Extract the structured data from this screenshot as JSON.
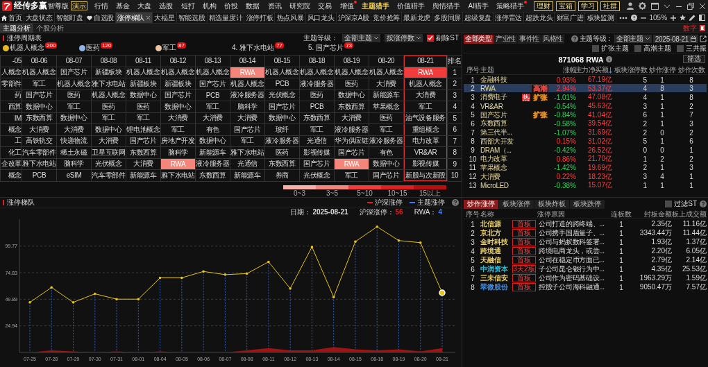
{
  "app": {
    "brand": "经传多赢",
    "edition": "智尊版",
    "badge": "演示"
  },
  "menu": [
    {
      "label": "行情",
      "selected": false,
      "dot": false
    },
    {
      "label": "基金",
      "selected": false,
      "dot": false
    },
    {
      "label": "大盘",
      "selected": false,
      "dot": false
    },
    {
      "label": "选股",
      "selected": false,
      "dot": false
    },
    {
      "label": "短打",
      "selected": false,
      "dot": false
    },
    {
      "label": "机构",
      "selected": false,
      "dot": false
    },
    {
      "label": "价投",
      "selected": false,
      "dot": false
    },
    {
      "label": "数据",
      "selected": false,
      "dot": false
    },
    {
      "label": "资讯",
      "selected": false,
      "dot": false
    },
    {
      "label": "研究院",
      "selected": false,
      "dot": false
    },
    {
      "label": "交易",
      "selected": false,
      "dot": false
    },
    {
      "label": "增值",
      "selected": false,
      "dot": true
    },
    {
      "label": "主题猎手",
      "selected": true,
      "dot": false
    },
    {
      "label": "价值猎手",
      "selected": false,
      "dot": false
    },
    {
      "label": "舆情猎手",
      "selected": false,
      "dot": false
    },
    {
      "label": "AI猎手",
      "selected": false,
      "dot": false
    },
    {
      "label": "策略猎手",
      "selected": false,
      "dot": true
    }
  ],
  "account_buttons": [
    "理财",
    "宝箱",
    "学习",
    "社群"
  ],
  "tabs": [
    {
      "label": "首页",
      "kind": "home",
      "selected": false
    },
    {
      "label": "大盘状态",
      "kind": "plain",
      "selected": false
    },
    {
      "label": "智能盯盘",
      "kind": "plain",
      "selected": false
    },
    {
      "label": "自选股",
      "kind": "favorite",
      "selected": false
    },
    {
      "label": "涨停梯队",
      "kind": "plain",
      "selected": true
    },
    {
      "label": "大福星",
      "kind": "plain",
      "selected": false
    },
    {
      "label": "智能选股",
      "kind": "plain",
      "selected": false
    },
    {
      "label": "精选量度计",
      "kind": "plain",
      "selected": false
    },
    {
      "label": "涨停打板",
      "kind": "plain",
      "selected": false
    },
    {
      "label": "热点风暴",
      "kind": "plain",
      "selected": false
    },
    {
      "label": "风口龙头",
      "kind": "plain",
      "selected": false
    },
    {
      "label": "沪深京A股",
      "kind": "plain",
      "selected": false
    },
    {
      "label": "竞价抢筹",
      "kind": "plain",
      "selected": false
    },
    {
      "label": "最新龙虎",
      "kind": "plain",
      "selected": false
    },
    {
      "label": "多股同屏",
      "kind": "plain",
      "selected": false
    },
    {
      "label": "超级复盘",
      "kind": "plain",
      "selected": false
    },
    {
      "label": "涨停雷达",
      "kind": "plain",
      "selected": false
    },
    {
      "label": "超跌龙头",
      "kind": "plain",
      "selected": false
    },
    {
      "label": "财富广进",
      "kind": "plain",
      "selected": false
    },
    {
      "label": "板块监测",
      "kind": "plain",
      "selected": false
    }
  ],
  "zoom": "105%",
  "subtabs": [
    {
      "label": "主题分析",
      "selected": true
    },
    {
      "label": "个股分析",
      "selected": false
    }
  ],
  "corner_label": "数字",
  "cycle": {
    "title": "涨停周期表",
    "themes": [
      {
        "kind": "medal",
        "label": "机器人概念",
        "count": "200",
        "color": "#e8b820"
      },
      {
        "kind": "medal",
        "label": "医药",
        "count": "120",
        "color": "#8fb4e8"
      },
      {
        "kind": "medal",
        "label": "军工",
        "count": "87",
        "color": "#e8c4a0"
      },
      {
        "kind": "numbered",
        "label": "4. 雅下水电站",
        "count": "77"
      },
      {
        "kind": "numbered",
        "label": "5. 国产芯片",
        "count": "73"
      }
    ],
    "level_label": "主题等级：",
    "level": "全部主题",
    "sort": "按涨停数",
    "exclude_st": {
      "label": "剔除ST",
      "checked": true
    },
    "columns": [
      {
        "label": "-05",
        "selected": false
      },
      {
        "label": "08-06",
        "selected": false
      },
      {
        "label": "08-07",
        "selected": false
      },
      {
        "label": "08-08",
        "selected": false
      },
      {
        "label": "08-11",
        "selected": false
      },
      {
        "label": "08-12",
        "selected": false
      },
      {
        "label": "08-13",
        "selected": false
      },
      {
        "label": "08-14",
        "selected": false
      },
      {
        "label": "08-15",
        "selected": false
      },
      {
        "label": "08-18",
        "selected": false
      },
      {
        "label": "08-19",
        "selected": false
      },
      {
        "label": "08-20",
        "selected": false
      },
      {
        "label": "08-21",
        "selected": true
      }
    ],
    "rank_label": "排名",
    "rows": [
      {
        "rank": "1",
        "cells": [
          "人概念",
          "机器人概念",
          "国产芯片",
          "新疆板块",
          "机器人概念",
          "机器人概念",
          "机器人概念",
          {
            "text": "RWA",
            "color": "#f4857a"
          },
          "机器人概念",
          "机器人概念",
          "机器人概念",
          "机器人概念",
          {
            "text": "RWA",
            "color": "#f23c3c"
          }
        ]
      },
      {
        "rank": "2",
        "cells": [
          "零部件",
          "军工",
          "机器人概念",
          "雅下水电站",
          "新疆板块",
          "新疆板块",
          "国产芯片",
          "机器人概念",
          "PCB",
          "液冷服务器",
          "医药",
          "大消费",
          "机器人概念"
        ]
      },
      {
        "rank": "3",
        "cells": [
          "药",
          "国产芯片",
          "医药",
          "机器人概念",
          "数据中心",
          "国产芯片",
          "PCB",
          "液冷服务器",
          "光伏概念",
          "医药",
          "数据中心",
          "新能源车",
          "大消费"
        ]
      },
      {
        "rank": "4",
        "cells": [
          "西算",
          "数据中心",
          "军工",
          "医药",
          "医药",
          "数据中心",
          "军工",
          "脑科学",
          "国产芯片",
          "PCB",
          "东数西算",
          "苹果概念",
          "军工"
        ]
      },
      {
        "rank": "5",
        "cells": [
          "IM",
          "东数西算",
          "数据中心",
          "军工",
          "军工",
          "大消费",
          "大消费",
          "大消费",
          "数据中心",
          "东数西算",
          "大消费",
          "医药",
          "油气设备服务"
        ]
      },
      {
        "rank": "6",
        "cells": [
          "概念",
          "大消费",
          "大消费",
          "数据中心",
          "锂电池概念",
          "军工",
          "有色",
          "国产芯片",
          "玻纤",
          "军工",
          "液冷服务器",
          "军工",
          "重组概念"
        ]
      },
      {
        "rank": "7",
        "cells": [
          "工",
          "高铁轨交",
          "快递物流",
          "大消费",
          "国产芯片",
          "房地产开发",
          "数据中心",
          "军工",
          "液冷服务器",
          "光通信",
          "华为供应链",
          "液冷服务器",
          "电力改革"
        ]
      },
      {
        "rank": "8",
        "cells": [
          "化工",
          "汽车零部件",
          "稀土永磁",
          "卫星互联网",
          "东数西算",
          "脑科学",
          "新能源车",
          "雅下水电站",
          "医药",
          "影视传媒",
          "国产芯片",
          "有色",
          "VR&AR"
        ]
      },
      {
        "rank": "9",
        "cells": [
          "企改革",
          "雅下水电站",
          "脑科学",
          "光伏概念",
          "大消费",
          {
            "text": "RWA",
            "color": "#f4857a"
          },
          "液冷服务器",
          "光通信",
          "东数西算",
          "国产芯片",
          {
            "text": "RWA",
            "color": "#f4857a"
          },
          "数据中心",
          "影视传媒"
        ]
      },
      {
        "rank": "10",
        "cells": [
          "概念",
          "PCB",
          "eSIM",
          "汽车零部件",
          "新能源车",
          "雅下水电站",
          "东数西算",
          "新能源车",
          "券商",
          "光伏概念",
          "军工",
          "国产芯片",
          "新股与次新股"
        ]
      }
    ],
    "legend": [
      {
        "label": "0~3",
        "color": "#f9b0a8"
      },
      {
        "label": "3~5",
        "color": "#f4857a"
      },
      {
        "label": "5~10",
        "color": "#f23c3c"
      },
      {
        "label": "10~15",
        "color": "#dc2020"
      },
      {
        "label": "15以上",
        "color": "#b81010"
      }
    ]
  },
  "trend": {
    "title": "涨停梯队",
    "legend_marks": [
      {
        "color": "#e02020"
      },
      {
        "color": "#3a7bff"
      }
    ],
    "info": [
      {
        "label": "日期：",
        "value": "2025-08-21",
        "color": "#dddddd"
      },
      {
        "label": "沪深涨停：",
        "value": "56",
        "color": "#e02020"
      },
      {
        "label": "RWA：",
        "value": "4",
        "color": "#3a7bff"
      }
    ],
    "chart_data": {
      "type": "line",
      "grid": true,
      "categories": [
        "07-25",
        "07-28",
        "07-29",
        "07-30",
        "07-31",
        "08-01",
        "08-04",
        "08-05",
        "08-06",
        "08-07",
        "08-08",
        "08-11",
        "08-12",
        "08-13",
        "08-14",
        "08-15",
        "08-18",
        "08-19",
        "08-20",
        "08-21"
      ],
      "ylim": [
        0,
        125
      ],
      "yticks": [
        24.94,
        49.89,
        74.83,
        99.77
      ],
      "series": [
        {
          "name": "沪深涨停",
          "type": "line",
          "color": "#e6c619",
          "values": [
            47,
            61,
            47,
            55,
            50,
            50,
            70,
            70,
            76,
            73,
            74,
            85,
            60,
            99,
            52,
            104,
            118,
            105,
            103,
            56
          ]
        },
        {
          "name": "主题涨停",
          "type": "area",
          "color": "#9b1515",
          "values": [
            0,
            2,
            1,
            0,
            1,
            0,
            1,
            0,
            0,
            0,
            2,
            4,
            2,
            2,
            5,
            3,
            2,
            3,
            1,
            4
          ]
        }
      ]
    }
  },
  "themes": {
    "tabs": [
      {
        "label": "全部类型",
        "selected": true
      },
      {
        "label": "产业性",
        "selected": false
      },
      {
        "label": "事件性",
        "selected": false
      },
      {
        "label": "风格性",
        "selected": false
      }
    ],
    "level_label": "主题等级：",
    "level": "全部主题",
    "date": "2025-08-21",
    "filters": [
      {
        "label": "扩张主题",
        "checked": false
      },
      {
        "label": "高潮主题",
        "checked": false
      },
      {
        "label": "三共振",
        "checked": false
      }
    ],
    "title": "871068 RWA",
    "filter_button": "筛选",
    "columns": [
      {
        "label": "序号",
        "sorted": false
      },
      {
        "label": "主题",
        "sorted": false
      },
      {
        "label": "涨幅",
        "sorted": false
      },
      {
        "label": "主力净买额",
        "sorted": true
      },
      {
        "label": "板块涨停数",
        "sorted": false
      },
      {
        "label": "炒作涨停",
        "sorted": false
      },
      {
        "label": "炒作次数",
        "sorted": false
      }
    ],
    "rows": [
      {
        "no": "1",
        "name": "金融科技",
        "change": "0.93%",
        "up": true,
        "net": "67.19亿",
        "count": "5",
        "hype": "1",
        "times": "8",
        "selected": false
      },
      {
        "no": "2",
        "name": "RWA",
        "tag": {
          "label": "高潮",
          "color": "#e04848"
        },
        "change": "2.94%",
        "up": true,
        "net": "53.37亿",
        "count": "4",
        "hype": "8",
        "times": "3",
        "selected": true
      },
      {
        "no": "3",
        "name": "消费电子",
        "hot": "热",
        "tag": {
          "label": "扩张",
          "color": "#e8902a"
        },
        "change": "-1.01%",
        "up": false,
        "net": "47.08亿",
        "count": "4",
        "hype": "1",
        "times": "8",
        "selected": false
      },
      {
        "no": "4",
        "name": "VR&AR",
        "change": "-0.54%",
        "up": false,
        "net": "45.63亿",
        "count": "3",
        "hype": "1",
        "times": "2",
        "selected": false
      },
      {
        "no": "5",
        "name": "国产芯片",
        "tag": {
          "label": "扩张",
          "color": "#e8902a"
        },
        "change": "-0.84%",
        "up": false,
        "net": "41.04亿",
        "count": "6",
        "hype": "1",
        "times": "7",
        "selected": false
      },
      {
        "no": "6",
        "name": "东数西算",
        "change": "-0.58%",
        "up": false,
        "net": "39.54亿",
        "count": "2",
        "hype": "1",
        "times": "3",
        "selected": false
      },
      {
        "no": "7",
        "name": "第三代半...",
        "change": "-1.07%",
        "up": false,
        "net": "31.69亿",
        "count": "2",
        "hype": "0",
        "times": "2",
        "selected": false
      },
      {
        "no": "8",
        "name": "西部大开发",
        "change": "0.15%",
        "up": true,
        "net": "31.02亿",
        "count": "5",
        "hype": "1",
        "times": "6",
        "selected": false
      },
      {
        "no": "9",
        "name": "DRAM（...",
        "change": "-0.42%",
        "up": false,
        "net": "26.52亿",
        "count": "0",
        "hype": "0",
        "times": "1",
        "selected": false
      },
      {
        "no": "10",
        "name": "电力改革",
        "change": "0.86%",
        "up": true,
        "net": "21.70亿",
        "count": "1",
        "hype": "2",
        "times": "2",
        "selected": false
      },
      {
        "no": "11",
        "name": "苹果概念",
        "change": "-1.42%",
        "up": false,
        "net": "19.69亿",
        "count": "2",
        "hype": "1",
        "times": "3",
        "selected": false
      },
      {
        "no": "12",
        "name": "大消费",
        "change": "0.22%",
        "up": true,
        "net": "18.23亿",
        "count": "3",
        "hype": "4",
        "times": "1",
        "selected": false
      },
      {
        "no": "13",
        "name": "MicroLED",
        "change": "-0.38%",
        "up": false,
        "net": "15.07亿",
        "count": "1",
        "hype": "1",
        "times": "1",
        "selected": false
      }
    ]
  },
  "limit_ups": {
    "tabs": [
      {
        "label": "炒作涨停",
        "selected": true
      },
      {
        "label": "板块涨停",
        "selected": false
      },
      {
        "label": "板块炸板",
        "selected": false
      },
      {
        "label": "板块跌停",
        "selected": false
      }
    ],
    "filter_st": {
      "label": "过滤ST",
      "checked": false
    },
    "columns": [
      "序号",
      "名称",
      "涨停原因",
      "连板数",
      "封板金额",
      "板上成交额"
    ],
    "rows": [
      {
        "no": "1",
        "name": "北信源",
        "color": "#e8d070",
        "tag": "首板",
        "reason": "公司打造的跨终端、...",
        "boards": "1",
        "seal": "2.35亿",
        "turnover": "11.16亿"
      },
      {
        "no": "2",
        "name": "京北方",
        "color": "#e8d070",
        "tag": "首板",
        "reason": "公司携手国盾量子、...",
        "boards": "1",
        "seal": "3343.44万",
        "turnover": "11.44亿"
      },
      {
        "no": "3",
        "name": "金时科技",
        "color": "#e8d070",
        "tag": "首板",
        "reason": "公司与蚂蚁数科签署...",
        "boards": "1",
        "seal": "1.93亿",
        "turnover": "1.37亿"
      },
      {
        "no": "4",
        "name": "跨境通",
        "color": "#e8d070",
        "tag": "首板",
        "reason": "跨境电商龙头，或尝...",
        "boards": "1",
        "seal": "2.20亿",
        "turnover": "6.05亿"
      },
      {
        "no": "5",
        "name": "天融信",
        "color": "#e8d070",
        "tag": "首板",
        "reason": "公司在稳定币方面已...",
        "boards": "1",
        "seal": "2.79亿",
        "turnover": "2.14亿"
      },
      {
        "no": "6",
        "name": "中润资本",
        "color": "#29c4e0",
        "tag": "3天2板",
        "reason": "子公司昆仑银行为中...",
        "boards": "1",
        "seal": "4.35亿",
        "turnover": "25.53亿"
      },
      {
        "no": "7",
        "name": "三未信安",
        "color": "#e8d070",
        "tag": "首板",
        "reason": "公司作为密码基础设...",
        "boards": "1",
        "seal": "1963.29万",
        "turnover": "1.59亿"
      },
      {
        "no": "8",
        "name": "翠微股份",
        "color": "#3a8ef0",
        "tag": "首板",
        "reason": "控股子公司海科融通...",
        "boards": "1",
        "seal": "9050.47万",
        "turnover": "7.57亿"
      }
    ]
  }
}
